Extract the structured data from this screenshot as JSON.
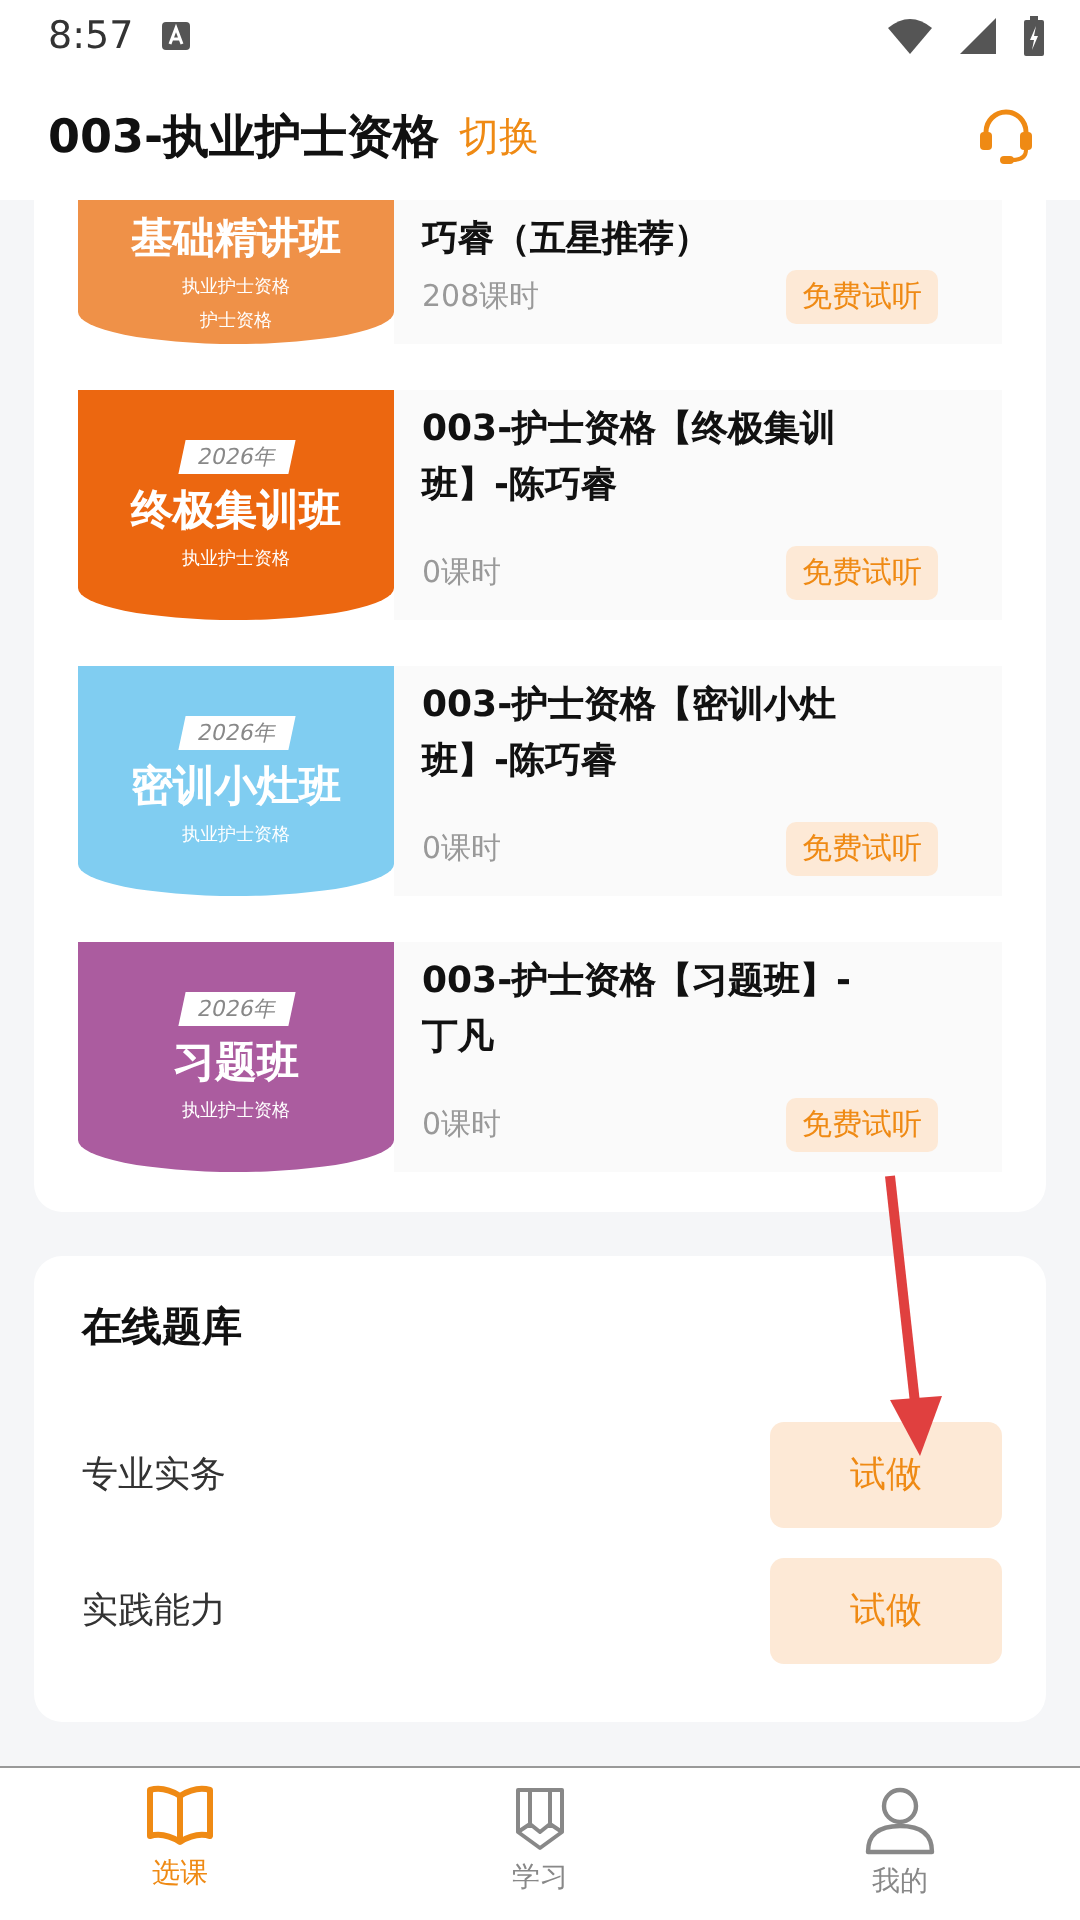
{
  "status_bar": {
    "time": "8:57"
  },
  "header": {
    "title": "003-执业护士资格",
    "switch_label": "切换"
  },
  "courses": [
    {
      "cover_title": "基础精讲班",
      "cover_subtitles": [
        "执业护士资格",
        "护士资格"
      ],
      "color": "#ef9148",
      "title": "巧睿（五星推荐）",
      "lessons": "208课时",
      "action": "免费试听"
    },
    {
      "cover_year": "2026年",
      "cover_title": "终极集训班",
      "cover_subtitles": [
        "执业护士资格"
      ],
      "color": "#ec6710",
      "title": "003-护士资格【终极集训班】-陈巧睿",
      "lessons": "0课时",
      "action": "免费试听"
    },
    {
      "cover_year": "2026年",
      "cover_title": "密训小灶班",
      "cover_subtitles": [
        "执业护士资格"
      ],
      "color": "#80cdf1",
      "title": "003-护士资格【密训小灶班】-陈巧睿",
      "lessons": "0课时",
      "action": "免费试听"
    },
    {
      "cover_year": "2026年",
      "cover_title": "习题班",
      "cover_subtitles": [
        "执业护士资格"
      ],
      "color": "#ab5c9f",
      "title": "003-护士资格【习题班】-丁凡",
      "lessons": "0课时",
      "action": "免费试听"
    }
  ],
  "question_bank": {
    "title": "在线题库",
    "items": [
      {
        "label": "专业实务",
        "action": "试做"
      },
      {
        "label": "实践能力",
        "action": "试做"
      }
    ]
  },
  "tabs": [
    {
      "label": "选课",
      "selected": true
    },
    {
      "label": "学习",
      "selected": false
    },
    {
      "label": "我的",
      "selected": false
    }
  ]
}
